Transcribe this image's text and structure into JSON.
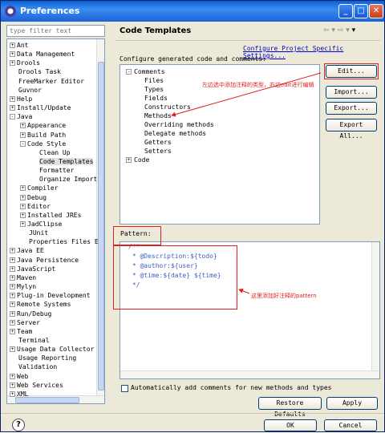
{
  "window": {
    "title": "Preferences"
  },
  "filter": {
    "placeholder": "type filter text"
  },
  "tree": [
    {
      "label": "Ant",
      "exp": "+",
      "indent": 0
    },
    {
      "label": "Data Management",
      "exp": "+",
      "indent": 0
    },
    {
      "label": "Drools",
      "exp": "+",
      "indent": 0
    },
    {
      "label": "Drools Task",
      "exp": "",
      "indent": 0
    },
    {
      "label": "FreeMarker Editor",
      "exp": "",
      "indent": 0
    },
    {
      "label": "Guvnor",
      "exp": "",
      "indent": 0
    },
    {
      "label": "Help",
      "exp": "+",
      "indent": 0
    },
    {
      "label": "Install/Update",
      "exp": "+",
      "indent": 0
    },
    {
      "label": "Java",
      "exp": "−",
      "indent": 0
    },
    {
      "label": "Appearance",
      "exp": "+",
      "indent": 1
    },
    {
      "label": "Build Path",
      "exp": "+",
      "indent": 1
    },
    {
      "label": "Code Style",
      "exp": "−",
      "indent": 1
    },
    {
      "label": "Clean Up",
      "exp": "",
      "indent": 2
    },
    {
      "label": "Code Templates",
      "exp": "",
      "indent": 2,
      "selected": true
    },
    {
      "label": "Formatter",
      "exp": "",
      "indent": 2
    },
    {
      "label": "Organize Import",
      "exp": "",
      "indent": 2
    },
    {
      "label": "Compiler",
      "exp": "+",
      "indent": 1
    },
    {
      "label": "Debug",
      "exp": "+",
      "indent": 1
    },
    {
      "label": "Editor",
      "exp": "+",
      "indent": 1
    },
    {
      "label": "Installed JREs",
      "exp": "+",
      "indent": 1
    },
    {
      "label": "JadClipse",
      "exp": "+",
      "indent": 1
    },
    {
      "label": "JUnit",
      "exp": "",
      "indent": 1
    },
    {
      "label": "Properties Files E",
      "exp": "",
      "indent": 1
    },
    {
      "label": "Java EE",
      "exp": "+",
      "indent": 0
    },
    {
      "label": "Java Persistence",
      "exp": "+",
      "indent": 0
    },
    {
      "label": "JavaScript",
      "exp": "+",
      "indent": 0
    },
    {
      "label": "Maven",
      "exp": "+",
      "indent": 0
    },
    {
      "label": "Mylyn",
      "exp": "+",
      "indent": 0
    },
    {
      "label": "Plug-in Development",
      "exp": "+",
      "indent": 0
    },
    {
      "label": "Remote Systems",
      "exp": "+",
      "indent": 0
    },
    {
      "label": "Run/Debug",
      "exp": "+",
      "indent": 0
    },
    {
      "label": "Server",
      "exp": "+",
      "indent": 0
    },
    {
      "label": "Team",
      "exp": "+",
      "indent": 0
    },
    {
      "label": "Terminal",
      "exp": "",
      "indent": 0
    },
    {
      "label": "Usage Data Collector",
      "exp": "+",
      "indent": 0
    },
    {
      "label": "Usage Reporting",
      "exp": "",
      "indent": 0
    },
    {
      "label": "Validation",
      "exp": "",
      "indent": 0
    },
    {
      "label": "Web",
      "exp": "+",
      "indent": 0
    },
    {
      "label": "Web Services",
      "exp": "+",
      "indent": 0
    },
    {
      "label": "XML",
      "exp": "+",
      "indent": 0
    }
  ],
  "panel": {
    "title": "Code Templates",
    "link": "Configure Project Specific Settings...",
    "config_label": "Configure generated code and comments:",
    "templates": [
      {
        "label": "Comments",
        "exp": "−",
        "indent": 0
      },
      {
        "label": "Files",
        "exp": "",
        "indent": 1
      },
      {
        "label": "Types",
        "exp": "",
        "indent": 1
      },
      {
        "label": "Fields",
        "exp": "",
        "indent": 1
      },
      {
        "label": "Constructors",
        "exp": "",
        "indent": 1
      },
      {
        "label": "Methods",
        "exp": "",
        "indent": 1
      },
      {
        "label": "Overriding methods",
        "exp": "",
        "indent": 1
      },
      {
        "label": "Delegate methods",
        "exp": "",
        "indent": 1
      },
      {
        "label": "Getters",
        "exp": "",
        "indent": 1
      },
      {
        "label": "Setters",
        "exp": "",
        "indent": 1
      },
      {
        "label": "Code",
        "exp": "+",
        "indent": 0
      }
    ],
    "buttons": {
      "edit": "Edit...",
      "import": "Import...",
      "export": "Export...",
      "export_all": "Export All..."
    },
    "pattern_label": "Pattern:",
    "pattern_lines": [
      "/**",
      " * @Description:${todo}",
      " * @author:${user}",
      " * @time:${date} ${time}",
      " */"
    ],
    "auto_comments": "Automatically add comments for new methods and types",
    "restore_defaults": "Restore Defaults",
    "apply": "Apply"
  },
  "footer": {
    "ok": "OK",
    "cancel": "Cancel",
    "help_icon": "?"
  },
  "annotations": {
    "left_note": "左边选中添加注释的类型，右边edit进行编辑",
    "pattern_note": "这里添加好注释的pattern"
  },
  "colors": {
    "annotation": "#e02020",
    "title_bar": "#0a5fd6",
    "pattern_text": "#3f5fbf"
  }
}
